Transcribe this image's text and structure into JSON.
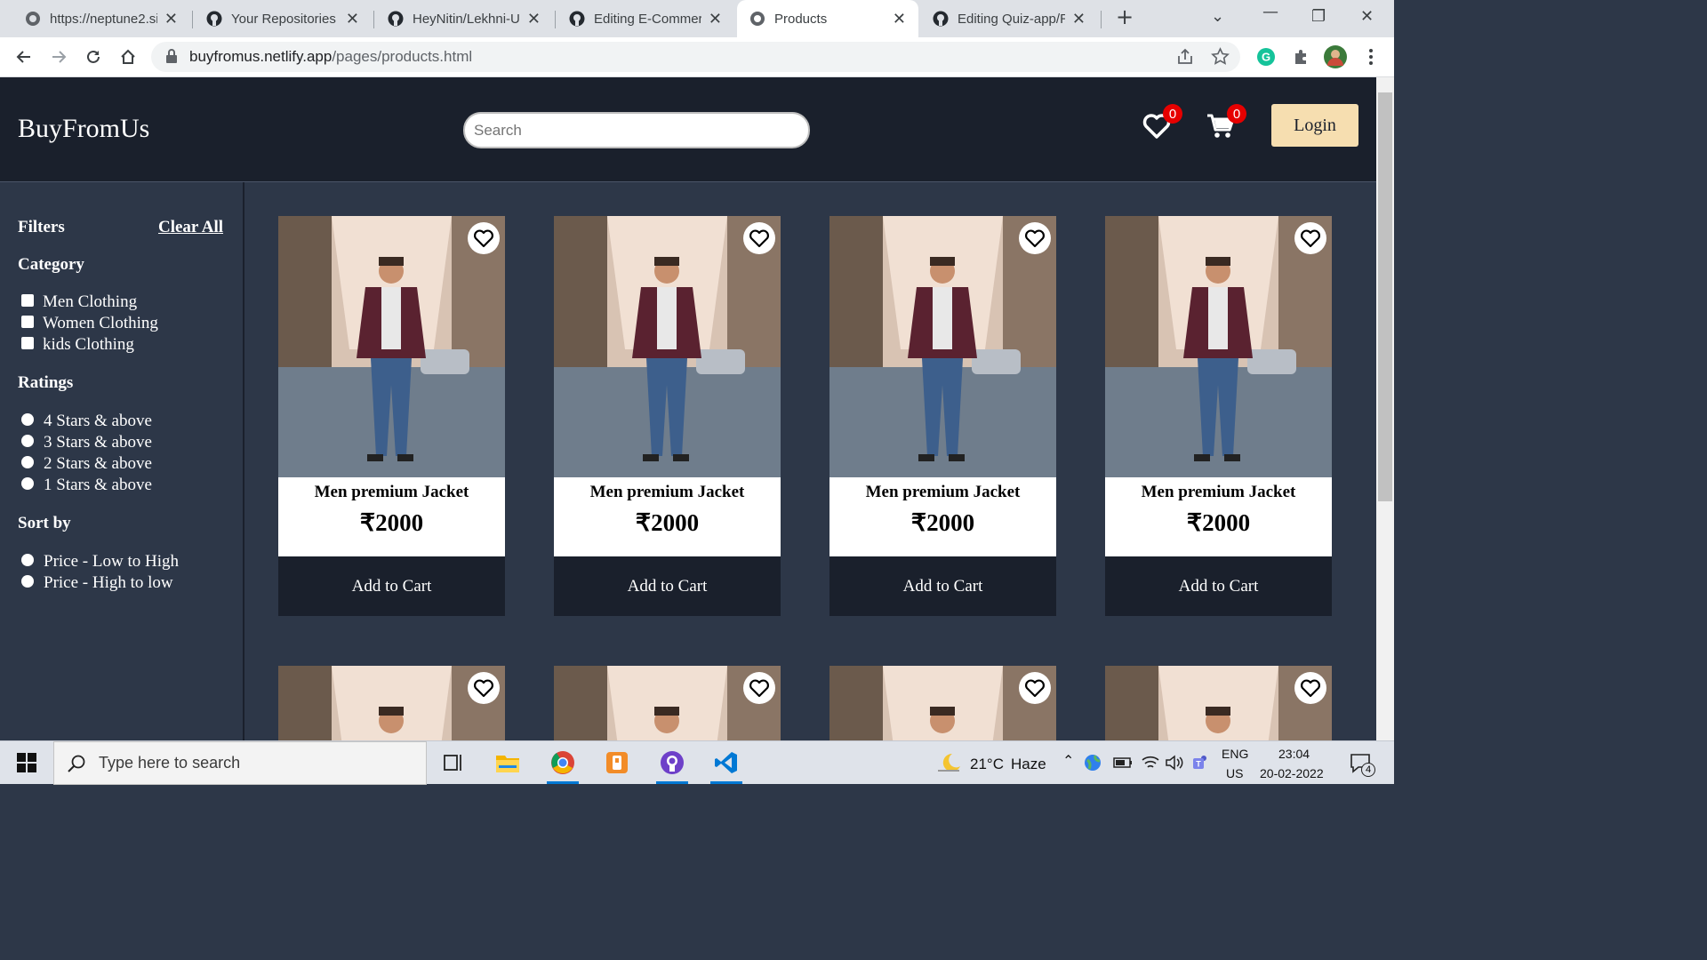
{
  "browser": {
    "tabs": [
      {
        "title": "https://neptune2.si",
        "icon": "globe-icon"
      },
      {
        "title": "Your Repositories",
        "icon": "github-icon"
      },
      {
        "title": "HeyNitin/Lekhni-UI",
        "icon": "github-icon"
      },
      {
        "title": "Editing E-Commerce",
        "icon": "github-icon"
      },
      {
        "title": "Products",
        "icon": "globe-icon",
        "active": true
      },
      {
        "title": "Editing Quiz-app/R",
        "icon": "github-icon"
      }
    ],
    "new_tab_glyph": "+",
    "address": {
      "domain": "buyfromus.netlify.app",
      "path": "/pages/products.html"
    }
  },
  "site": {
    "brand": "BuyFromUs",
    "search_placeholder": "Search",
    "wishlist_count": "0",
    "cart_count": "0",
    "login_label": "Login"
  },
  "filters": {
    "heading": "Filters",
    "clear_label": "Clear All",
    "category_heading": "Category",
    "categories": [
      "Men Clothing",
      "Women Clothing",
      "kids Clothing"
    ],
    "ratings_heading": "Ratings",
    "ratings": [
      "4 Stars & above",
      "3 Stars & above",
      "2 Stars & above",
      "1 Stars & above"
    ],
    "sort_heading": "Sort by",
    "sort_options": [
      "Price - Low to High",
      "Price - High to low"
    ]
  },
  "products": [
    {
      "title": "Men premium Jacket",
      "price": "₹2000",
      "cta": "Add to Cart"
    },
    {
      "title": "Men premium Jacket",
      "price": "₹2000",
      "cta": "Add to Cart"
    },
    {
      "title": "Men premium Jacket",
      "price": "₹2000",
      "cta": "Add to Cart"
    },
    {
      "title": "Men premium Jacket",
      "price": "₹2000",
      "cta": "Add to Cart"
    }
  ],
  "taskbar": {
    "search_placeholder": "Type here to search",
    "weather_temp": "21°C",
    "weather_desc": "Haze",
    "lang_line1": "ENG",
    "lang_line2": "US",
    "time": "23:04",
    "date": "20-02-2022",
    "notification_count": "4"
  }
}
